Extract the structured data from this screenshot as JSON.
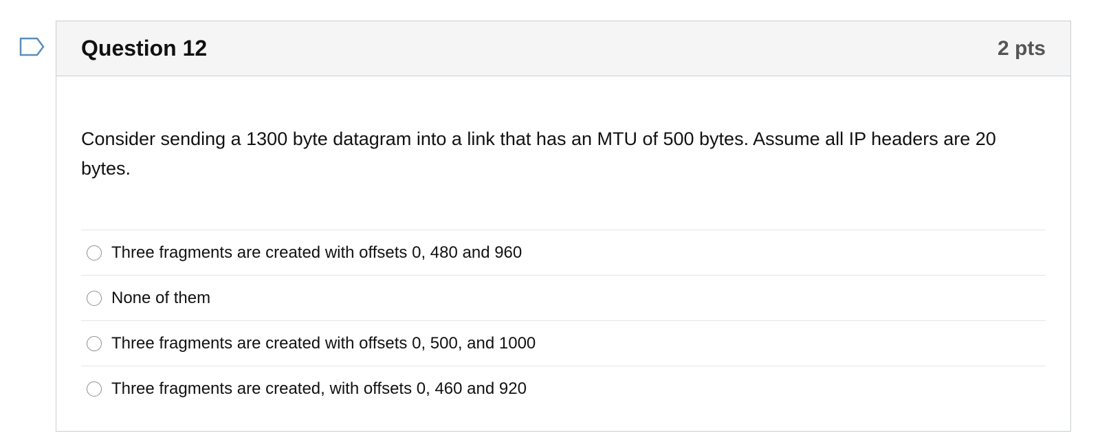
{
  "question": {
    "title": "Question 12",
    "points": "2 pts",
    "text": "Consider sending a 1300 byte datagram into a link that has an MTU of 500 bytes.  Assume all IP headers are 20 bytes.",
    "answers": [
      {
        "label": "Three fragments are created with offsets 0, 480 and 960",
        "selected": false
      },
      {
        "label": "None of them",
        "selected": false
      },
      {
        "label": "Three fragments are created with offsets 0, 500, and 1000",
        "selected": false
      },
      {
        "label": "Three fragments are created, with offsets 0, 460 and 920",
        "selected": false
      }
    ]
  },
  "icons": {
    "flag": "bookmark-flag-icon"
  },
  "colors": {
    "flag_outline": "#5b8db8",
    "header_bg": "#f5f5f5",
    "border": "#c7cdd1"
  }
}
